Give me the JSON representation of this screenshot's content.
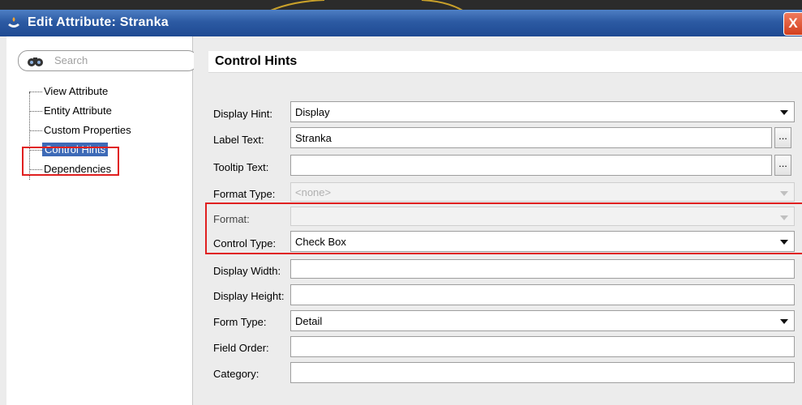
{
  "window": {
    "title": "Edit Attribute: Stranka",
    "close_symbol": "X"
  },
  "search": {
    "placeholder": "Search"
  },
  "nav": {
    "items": [
      {
        "label": "View Attribute"
      },
      {
        "label": "Entity Attribute"
      },
      {
        "label": "Custom Properties"
      },
      {
        "label": "Control Hints",
        "selected": true
      },
      {
        "label": "Dependencies"
      }
    ]
  },
  "section": {
    "title": "Control Hints"
  },
  "form": {
    "display_hint": {
      "label": "Display Hint:",
      "value": "Display"
    },
    "label_text": {
      "label": "Label Text:",
      "value": "Stranka"
    },
    "tooltip_text": {
      "label": "Tooltip Text:",
      "value": ""
    },
    "format_type": {
      "label": "Format Type:",
      "value": "<none>"
    },
    "format": {
      "label": "Format:",
      "value": ""
    },
    "control_type": {
      "label": "Control Type:",
      "value": "Check Box"
    },
    "display_width": {
      "label": "Display Width:",
      "value": ""
    },
    "display_height": {
      "label": "Display Height:",
      "value": ""
    },
    "form_type": {
      "label": "Form Type:",
      "value": "Detail"
    },
    "field_order": {
      "label": "Field Order:",
      "value": ""
    },
    "category": {
      "label": "Category:",
      "value": ""
    },
    "ellipsis_label": "..."
  },
  "colors": {
    "titlebar": "#2c5aa3",
    "selection": "#3d6ab7",
    "highlight": "#e02020"
  }
}
